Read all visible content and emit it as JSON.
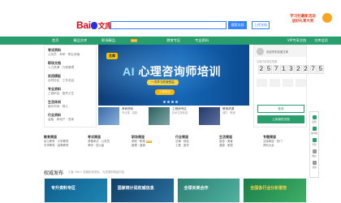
{
  "header": {
    "logo_text": "Bai",
    "logo_suffix": "文库",
    "search_button": "搜索文档",
    "upload_button": "上传文档",
    "promo_line1": "学习社最新活动",
    "promo_line2": "送好礼享大奖"
  },
  "nav": {
    "items": [
      "首页",
      "精品文库",
      "职场精品",
      "教育专区",
      "专业资料"
    ],
    "hot_label": "HOT",
    "right_items": [
      "VIP专享文档",
      "文库会员"
    ]
  },
  "categories": [
    {
      "title": "考试资料",
      "sub": "公务员 · 考研 · 职业资格"
    },
    {
      "title": "职场文档",
      "sub": "人力资源 · 行政管理"
    },
    {
      "title": "实用模板",
      "sub": "合同协议 · 工作总结"
    },
    {
      "title": "专业资料",
      "sub": "工程科技 · 医药卫生"
    },
    {
      "title": "生活休闲",
      "sub": "娱乐时尚 · 育儿"
    },
    {
      "title": "行业资料",
      "sub": "金融 · 房地产 · 咨询"
    }
  ],
  "banner": {
    "tag": "文库",
    "headline_ai": "AI",
    "headline": "心理咨询师培训",
    "subline": "一次学习终身受益",
    "cta": "立即报名"
  },
  "mini_cards": [
    {
      "title": "考研资料",
      "sub": "专业课 · 真题"
    },
    {
      "title": "工程师专区",
      "sub": "技术文档精选"
    },
    {
      "title": "教育资源",
      "sub": "课件 · 教案"
    }
  ],
  "user_panel": {
    "greeting": "欢迎来到百度文库",
    "count_label": "文库已收录文档数",
    "count_digits": [
      "2",
      "5",
      "7",
      "1",
      "3",
      "2",
      "2",
      "7",
      "5"
    ],
    "login_button": "登录",
    "upload_button": "上传我的文档"
  },
  "tools": [
    "反馈",
    "客户端",
    "手机",
    "微信",
    "顶部"
  ],
  "category_columns": [
    {
      "heading": "教育频道",
      "links": [
        "幼儿教育 · 小学教育",
        "中学教育 · 高等教育"
      ]
    },
    {
      "heading": "考试频道",
      "links": [
        "资格考试 · 公务员",
        "考研 · 四六级"
      ]
    },
    {
      "heading": "职场频道",
      "links": [
        "求职 · 职场",
        "管理 · 营销"
      ]
    },
    {
      "heading": "行业频道",
      "links": [
        "法律 · 财经",
        "工程 · 医学"
      ]
    },
    {
      "heading": "生活频道",
      "links": [
        "旅游 · 美食",
        "健康 · 家居"
      ]
    },
    {
      "heading": "专题频道",
      "links": [
        "文库精选 · 热门",
        "资料大全"
      ]
    }
  ],
  "new_badge": "NEW",
  "authority": {
    "title": "权威发布",
    "subtitle": "汇聚 300+ 权威机构资料，为您提供精品内容"
  },
  "cards": [
    "专升资料专区",
    "国家统计局权威信息",
    "全球买卖合作",
    "全国各行业分析报告"
  ]
}
